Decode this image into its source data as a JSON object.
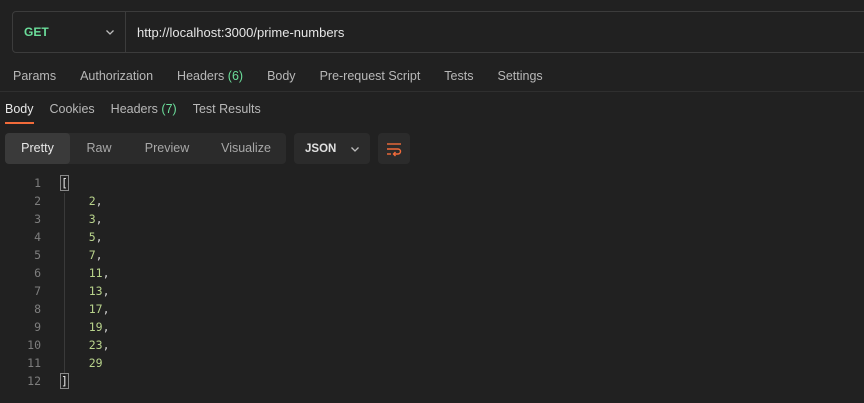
{
  "request": {
    "method": "GET",
    "url": "http://localhost:3000/prime-numbers"
  },
  "request_tabs": [
    {
      "label": "Params",
      "count": ""
    },
    {
      "label": "Authorization",
      "count": ""
    },
    {
      "label": "Headers",
      "count": "(6)"
    },
    {
      "label": "Body",
      "count": ""
    },
    {
      "label": "Pre-request Script",
      "count": ""
    },
    {
      "label": "Tests",
      "count": ""
    },
    {
      "label": "Settings",
      "count": ""
    }
  ],
  "response_tabs": [
    {
      "label": "Body",
      "count": "",
      "active": true
    },
    {
      "label": "Cookies",
      "count": "",
      "active": false
    },
    {
      "label": "Headers",
      "count": "(7)",
      "active": false
    },
    {
      "label": "Test Results",
      "count": "",
      "active": false
    }
  ],
  "view_modes": [
    "Pretty",
    "Raw",
    "Preview",
    "Visualize"
  ],
  "active_view": "Pretty",
  "format": "JSON",
  "icons": {
    "method_dropdown": "chevron-down-icon",
    "format_dropdown": "chevron-down-icon",
    "wrap": "wrap-lines-icon"
  },
  "colors": {
    "accent": "#f26b3a",
    "method_get": "#6bdd9a",
    "number": "#b9d48c"
  },
  "code_lines": [
    {
      "no": "1",
      "parts": [
        {
          "t": "[",
          "c": "bracket"
        }
      ]
    },
    {
      "no": "2",
      "parts": [
        {
          "t": "    ",
          "c": "punct"
        },
        {
          "t": "2",
          "c": "num"
        },
        {
          "t": ",",
          "c": "punct"
        }
      ]
    },
    {
      "no": "3",
      "parts": [
        {
          "t": "    ",
          "c": "punct"
        },
        {
          "t": "3",
          "c": "num"
        },
        {
          "t": ",",
          "c": "punct"
        }
      ]
    },
    {
      "no": "4",
      "parts": [
        {
          "t": "    ",
          "c": "punct"
        },
        {
          "t": "5",
          "c": "num"
        },
        {
          "t": ",",
          "c": "punct"
        }
      ]
    },
    {
      "no": "5",
      "parts": [
        {
          "t": "    ",
          "c": "punct"
        },
        {
          "t": "7",
          "c": "num"
        },
        {
          "t": ",",
          "c": "punct"
        }
      ]
    },
    {
      "no": "6",
      "parts": [
        {
          "t": "    ",
          "c": "punct"
        },
        {
          "t": "11",
          "c": "num"
        },
        {
          "t": ",",
          "c": "punct"
        }
      ]
    },
    {
      "no": "7",
      "parts": [
        {
          "t": "    ",
          "c": "punct"
        },
        {
          "t": "13",
          "c": "num"
        },
        {
          "t": ",",
          "c": "punct"
        }
      ]
    },
    {
      "no": "8",
      "parts": [
        {
          "t": "    ",
          "c": "punct"
        },
        {
          "t": "17",
          "c": "num"
        },
        {
          "t": ",",
          "c": "punct"
        }
      ]
    },
    {
      "no": "9",
      "parts": [
        {
          "t": "    ",
          "c": "punct"
        },
        {
          "t": "19",
          "c": "num"
        },
        {
          "t": ",",
          "c": "punct"
        }
      ]
    },
    {
      "no": "10",
      "parts": [
        {
          "t": "    ",
          "c": "punct"
        },
        {
          "t": "23",
          "c": "num"
        },
        {
          "t": ",",
          "c": "punct"
        }
      ]
    },
    {
      "no": "11",
      "parts": [
        {
          "t": "    ",
          "c": "punct"
        },
        {
          "t": "29",
          "c": "num"
        }
      ]
    },
    {
      "no": "12",
      "parts": [
        {
          "t": "]",
          "c": "bracket"
        }
      ]
    }
  ]
}
